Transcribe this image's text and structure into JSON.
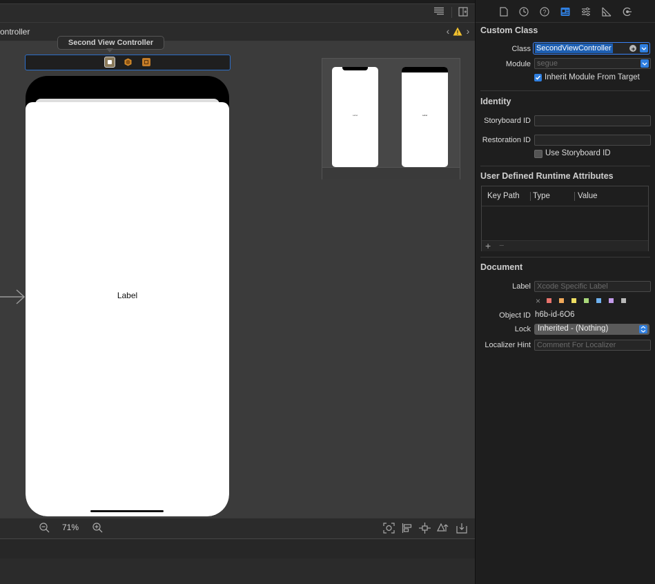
{
  "editor": {
    "breadcrumb": "ontroller",
    "scene_tooltip": "Second View Controller",
    "device_label": "Label",
    "minimap_left_label": "Label",
    "minimap_right_label": "Label",
    "zoom_level": "71%",
    "warning_symbol": "!"
  },
  "inspector": {
    "custom_class": {
      "title": "Custom Class",
      "class_label": "Class",
      "class_value": "SecondViewController",
      "module_label": "Module",
      "module_placeholder": "segue",
      "inherit_label": "Inherit Module From Target"
    },
    "identity": {
      "title": "Identity",
      "storyboard_id_label": "Storyboard ID",
      "restoration_id_label": "Restoration ID",
      "use_storyboard_label": "Use Storyboard ID"
    },
    "runtime": {
      "title": "User Defined Runtime Attributes",
      "columns": [
        "Key Path",
        "Type",
        "Value"
      ],
      "add": "+",
      "remove": "−"
    },
    "document": {
      "title": "Document",
      "label_label": "Label",
      "label_placeholder": "Xcode Specific Label",
      "object_id_label": "Object ID",
      "object_id_value": "h6b-id-6O6",
      "lock_label": "Lock",
      "lock_value": "Inherited - (Nothing)",
      "localizer_label": "Localizer Hint",
      "localizer_placeholder": "Comment For Localizer",
      "clear_symbol": "×",
      "swatch_colors": [
        "#e8736c",
        "#f0a95a",
        "#eedd62",
        "#a9d87a",
        "#6fb2f0",
        "#c39bea",
        "#b9b9b9"
      ]
    }
  }
}
